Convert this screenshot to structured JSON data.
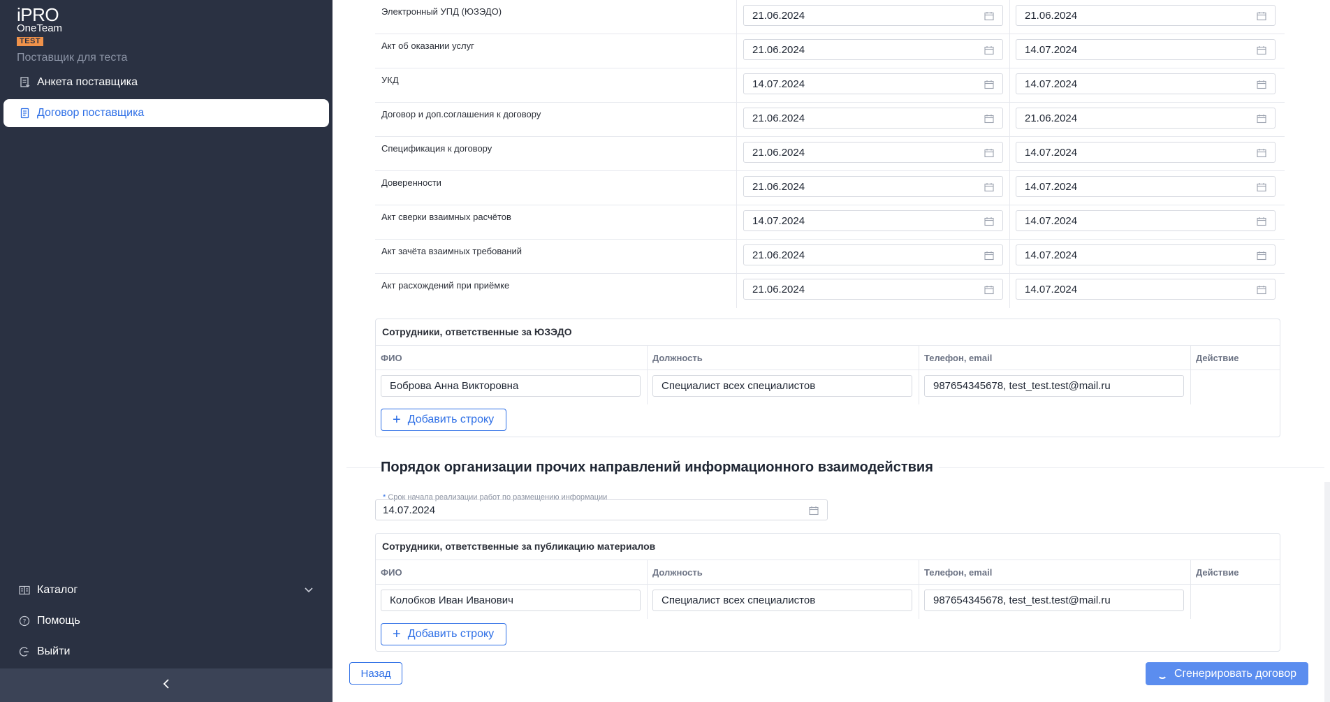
{
  "sidebar": {
    "logo": {
      "brand": "iPRO",
      "product": "OneTeam",
      "env_badge": "TEST"
    },
    "org_name": "Поставщик для теста",
    "items": [
      {
        "label": "Анкета поставщика",
        "icon": "document-icon"
      },
      {
        "label": "Договор поставщика",
        "icon": "contract-icon"
      }
    ],
    "bottom_items": [
      {
        "label": "Каталог",
        "icon": "catalog-icon"
      },
      {
        "label": "Помощь",
        "icon": "help-icon"
      },
      {
        "label": "Выйти",
        "icon": "logout-icon"
      }
    ],
    "collapse_icon": "chevron-left-icon"
  },
  "documents": [
    {
      "name": "Электронный УПД (ЮЗЭДО)",
      "date_from": "21.06.2024",
      "date_to": "21.06.2024"
    },
    {
      "name": "Акт об оказании услуг",
      "date_from": "21.06.2024",
      "date_to": "14.07.2024"
    },
    {
      "name": "УКД",
      "date_from": "14.07.2024",
      "date_to": "14.07.2024"
    },
    {
      "name": "Договор и доп.соглашения к договору",
      "date_from": "21.06.2024",
      "date_to": "21.06.2024"
    },
    {
      "name": "Спецификация к договору",
      "date_from": "21.06.2024",
      "date_to": "14.07.2024"
    },
    {
      "name": "Доверенности",
      "date_from": "21.06.2024",
      "date_to": "14.07.2024"
    },
    {
      "name": "Акт сверки взаимных расчётов",
      "date_from": "14.07.2024",
      "date_to": "14.07.2024"
    },
    {
      "name": "Акт зачёта взаимных требований",
      "date_from": "21.06.2024",
      "date_to": "14.07.2024"
    },
    {
      "name": "Акт расхождений при приёмке",
      "date_from": "21.06.2024",
      "date_to": "14.07.2024"
    }
  ],
  "edo_staff": {
    "title": "Сотрудники, ответственные за ЮЗЭДО",
    "columns": [
      "ФИО",
      "Должность",
      "Телефон, email",
      "Действие"
    ],
    "rows": [
      {
        "fio": "Боброва Анна Викторовна",
        "position": "Специалист всех специалистов",
        "contact": "987654345678, test_test.test@mail.ru"
      }
    ],
    "add_row_label": "Добавить строку"
  },
  "other_section": {
    "heading": "Порядок организации прочих направлений информационного взаимодействия",
    "start_field": {
      "required_mark": "*",
      "label": "Срок начала реализации работ по размещению информации",
      "value": "14.07.2024"
    }
  },
  "pub_staff": {
    "title": "Сотрудники, ответственные за публикацию материалов",
    "columns": [
      "ФИО",
      "Должность",
      "Телефон, email",
      "Действие"
    ],
    "rows": [
      {
        "fio": "Колобков Иван Иванович",
        "position": "Специалист всех специалистов",
        "contact": "987654345678, test_test.test@mail.ru"
      }
    ],
    "add_row_label": "Добавить строку"
  },
  "footer": {
    "back_label": "Назад",
    "generate_label": "Сгенерировать договор"
  },
  "colors": {
    "sidebar_bg": "#2a3142",
    "accent": "#2e6fe6",
    "primary_button": "#5b8def",
    "test_badge": "#f0924a"
  }
}
